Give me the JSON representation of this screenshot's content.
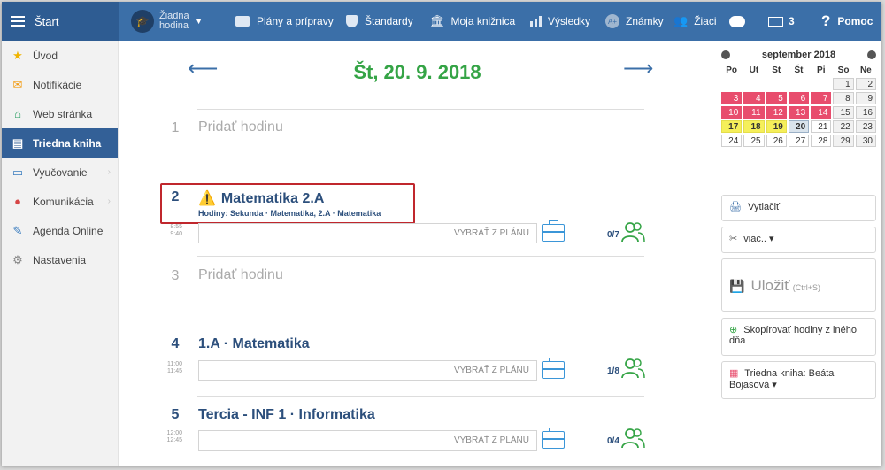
{
  "topbar": {
    "start_label": "Štart",
    "hour_label_1": "Žiadna",
    "hour_label_2": "hodina",
    "plans_label": "Plány a prípravy",
    "standards_label": "Štandardy",
    "library_label": "Moja knižnica",
    "results_label": "Výsledky",
    "grades_label": "Známky",
    "students_label": "Žiaci",
    "messages_count": "3",
    "help_label": "Pomoc"
  },
  "sidebar": {
    "items": [
      {
        "label": "Úvod",
        "icon": "star-icon"
      },
      {
        "label": "Notifikácie",
        "icon": "envelope-icon"
      },
      {
        "label": "Web stránka",
        "icon": "home-icon"
      },
      {
        "label": "Triedna kniha",
        "icon": "book-icon"
      },
      {
        "label": "Vyučovanie",
        "icon": "board-icon"
      },
      {
        "label": "Komunikácia",
        "icon": "chat-icon"
      },
      {
        "label": "Agenda Online",
        "icon": "pen-icon"
      },
      {
        "label": "Nastavenia",
        "icon": "gear-icon"
      }
    ]
  },
  "main": {
    "date": "Št, 20. 9. 2018",
    "lessons": [
      {
        "number": "1",
        "add_label": "Pridať hodinu"
      },
      {
        "number": "2",
        "title": "Matematika 2.A",
        "hodiny": "Hodiny: Sekunda · Matematika, 2.A · Matematika",
        "time_start": "8:55",
        "time_end": "9:40",
        "plan_label": "VYBRAŤ Z PLÁNU",
        "count": "0/7"
      },
      {
        "number": "3",
        "add_label": "Pridať hodinu"
      },
      {
        "number": "4",
        "title": "1.A · Matematika",
        "time_start": "11:00",
        "time_end": "11:45",
        "plan_label": "VYBRAŤ Z PLÁNU",
        "count": "1/8"
      },
      {
        "number": "5",
        "title": "Tercia - INF 1 · Informatika",
        "time_start": "12:00",
        "time_end": "12:45",
        "plan_label": "VYBRAŤ Z PLÁNU",
        "count": "0/4"
      }
    ]
  },
  "calendar": {
    "month": "september 2018",
    "weekdays": [
      "Po",
      "Ut",
      "St",
      "Št",
      "Pi",
      "So",
      "Ne"
    ],
    "rows": [
      [
        "",
        "",
        "",
        "",
        "",
        "1",
        "2"
      ],
      [
        "3",
        "4",
        "5",
        "6",
        "7",
        "8",
        "9"
      ],
      [
        "10",
        "11",
        "12",
        "13",
        "14",
        "15",
        "16"
      ],
      [
        "17",
        "18",
        "19",
        "20",
        "21",
        "22",
        "23"
      ],
      [
        "24",
        "25",
        "26",
        "27",
        "28",
        "29",
        "30"
      ]
    ],
    "colors": {
      "pink": "#e84d6d",
      "yellow": "#f5ef5a"
    }
  },
  "right": {
    "print_label": "Vytlačiť",
    "more_label": "viac.. ▾",
    "save_label": "Uložiť",
    "save_shortcut": "(Ctrl+S)",
    "copy_label": "Skopírovať hodiny z iného dňa",
    "classbook_label": "Triedna kniha: Beáta Bojasová ▾"
  },
  "colors": {
    "accent": "#3b6fa8",
    "green": "#35a446",
    "highlight_border": "#c0272d"
  }
}
